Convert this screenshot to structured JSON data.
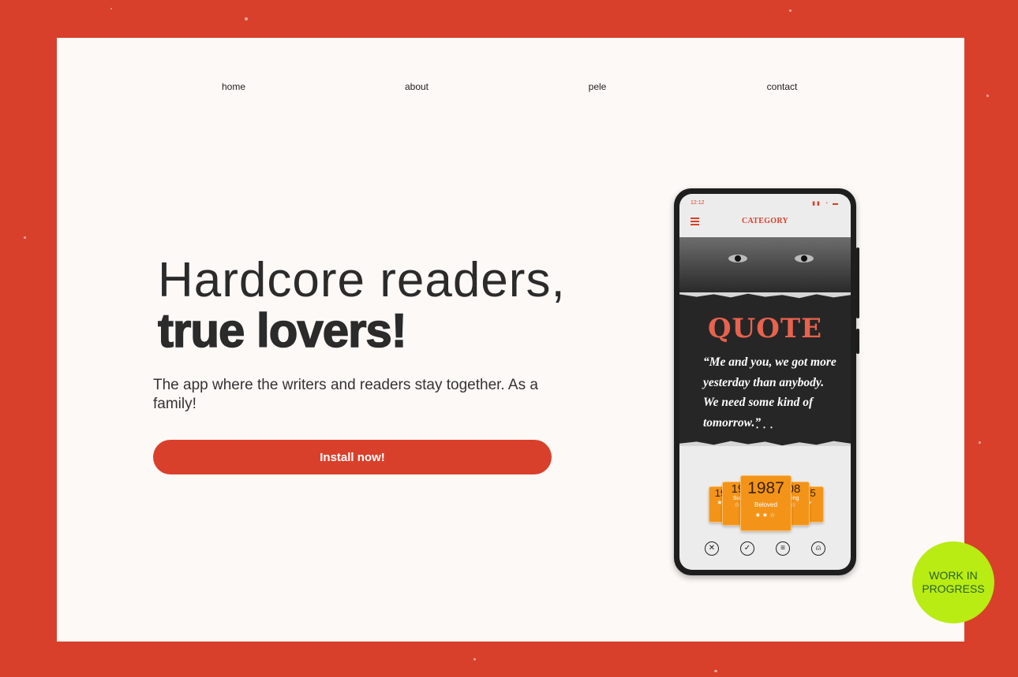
{
  "nav": {
    "home": "home",
    "about": "about",
    "pele": "pele",
    "contact": "contact"
  },
  "hero": {
    "headline_line1": "Hardcore readers,",
    "headline_line2": "true lovers!",
    "subtitle": "The app where the writers and readers stay together. As a family!",
    "install_label": "Install now!"
  },
  "phone": {
    "status_time": "12:12",
    "header_title": "CATEGORY",
    "quote_title": "QUOTE",
    "quote_text": "“Me and you, we got more yesterday than anybody. We need some kind of tomorrow.”",
    "dots": "• • •",
    "cards": [
      {
        "year": "19",
        "title": "",
        "stars": 1
      },
      {
        "year": "19",
        "title": "Sun",
        "stars": 1
      },
      {
        "year": "1987",
        "title": "Beloved",
        "stars": 2
      },
      {
        "year": "08",
        "title": "ying",
        "stars": 1
      },
      {
        "year": "15",
        "title": "",
        "stars": 1
      }
    ],
    "tabbar_icons": [
      "close-icon",
      "check-icon",
      "message-icon",
      "profile-icon"
    ]
  },
  "badge": {
    "text": "WORK IN PROGRESS"
  },
  "colors": {
    "background": "#d9402b",
    "card": "#fdf9f7",
    "accent": "#d9402b",
    "badge": "#b8ec13",
    "year_card": "#f39419"
  }
}
